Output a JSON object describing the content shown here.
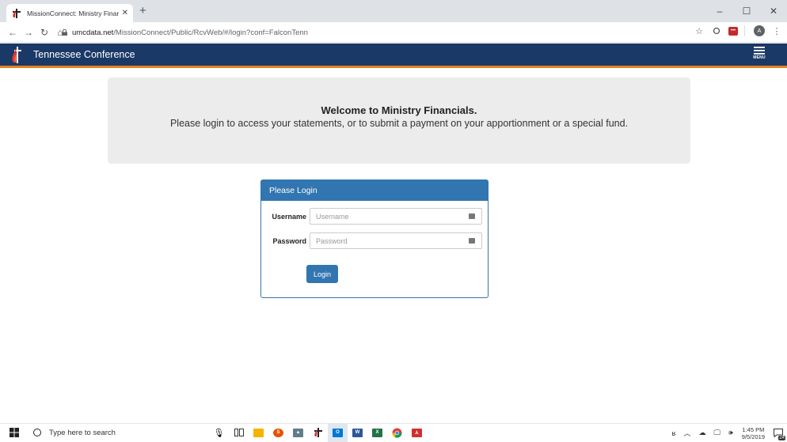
{
  "browser": {
    "tab_title": "MissionConnect: Ministry Financ",
    "tab_close": "✕",
    "new_tab": "+",
    "minimize": "–",
    "maximize": "☐",
    "close": "✕",
    "back": "←",
    "forward": "→",
    "reload": "↻",
    "home": "⌂",
    "url_host": "umcdata.net",
    "url_path": "/MissionConnect/Public/RcvWeb/#/login?conf=FalconTenn",
    "star": "☆",
    "profile_initial": "A",
    "more": "⋮"
  },
  "header": {
    "title": "Tennessee Conference",
    "menu_label": "MENU",
    "bar_color": "#1a3966",
    "accent_color": "#e67e22"
  },
  "welcome": {
    "title": "Welcome to Ministry Financials.",
    "message": "Please login to access your statements, or to submit a payment on your apportionment or a special fund."
  },
  "login": {
    "heading": "Please Login",
    "username_label": "Username",
    "username_placeholder": "Username",
    "username_value": "",
    "password_label": "Password",
    "password_placeholder": "Password",
    "password_value": "",
    "submit_label": "Login",
    "primary_color": "#3276b1"
  },
  "taskbar": {
    "search_placeholder": "Type here to search",
    "apps": [
      "microphone-icon",
      "task-view-icon",
      "file-explorer-icon",
      "snagit-icon",
      "onedrive-icon",
      "missionconnect-icon",
      "outlook-icon",
      "word-icon",
      "excel-icon",
      "chrome-icon",
      "acrobat-icon"
    ],
    "time": "1:45 PM",
    "date": "9/5/2019",
    "notification_count": "24"
  }
}
